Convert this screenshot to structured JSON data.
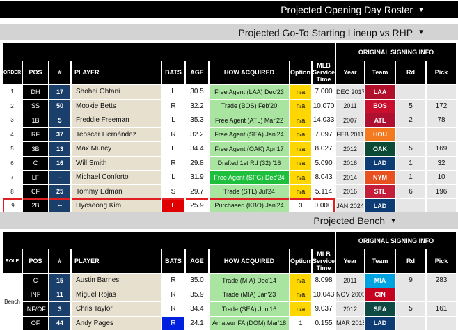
{
  "header": {
    "roster_title": "Projected Opening Day Roster",
    "lineup_title": "Projected Go-To Starting Lineup vs RHP",
    "bench_title": "Projected Bench"
  },
  "columns": {
    "order": "ORDER",
    "role": "ROLE",
    "pos": "POS",
    "num": "#",
    "player": "PLAYER",
    "bats": "BATS",
    "age": "AGE",
    "how_acquired": "HOW ACQUIRED",
    "options": "Options",
    "service": "MLB Service Time",
    "signing_header": "ORIGINAL SIGNING INFO",
    "year": "Year",
    "team": "Team",
    "rd": "Rd",
    "pick": "Pick"
  },
  "lineup": [
    {
      "order": "1",
      "pos": "DH",
      "num": "17",
      "player": "Shohei Ohtani",
      "bats": "L",
      "age": "30.5",
      "acquired": "Free Agent (LAA) Dec'23",
      "options": "n/a",
      "service": "7.000",
      "year": "DEC 2017",
      "team": "LAA",
      "team_color": "#b0102a",
      "rd": "",
      "pick": ""
    },
    {
      "order": "2",
      "pos": "SS",
      "num": "50",
      "player": "Mookie Betts",
      "bats": "R",
      "age": "32.2",
      "acquired": "Trade (BOS) Feb'20",
      "options": "n/a",
      "service": "10.070",
      "year": "2011",
      "team": "BOS",
      "team_color": "#c8102e",
      "rd": "5",
      "pick": "172"
    },
    {
      "order": "3",
      "pos": "1B",
      "num": "5",
      "player": "Freddie Freeman",
      "bats": "L",
      "age": "35.3",
      "acquired": "Free Agent (ATL) Mar'22",
      "options": "n/a",
      "service": "14.033",
      "year": "2007",
      "team": "ATL",
      "team_color": "#b01030",
      "rd": "2",
      "pick": "78"
    },
    {
      "order": "4",
      "pos": "RF",
      "num": "37",
      "player": "Teoscar Hernández",
      "bats": "R",
      "age": "32.2",
      "acquired": "Free Agent (SEA) Jan'24",
      "options": "n/a",
      "service": "7.097",
      "year": "FEB 2011",
      "team": "HOU",
      "team_color": "#f47a20",
      "rd": "",
      "pick": ""
    },
    {
      "order": "5",
      "pos": "3B",
      "num": "13",
      "player": "Max Muncy",
      "bats": "L",
      "age": "34.4",
      "acquired": "Free Agent (OAK) Apr'17",
      "options": "n/a",
      "service": "8.027",
      "year": "2012",
      "team": "OAK",
      "team_color": "#0b4a35",
      "rd": "5",
      "pick": "169"
    },
    {
      "order": "6",
      "pos": "C",
      "num": "16",
      "player": "Will Smith",
      "bats": "R",
      "age": "29.8",
      "acquired": "Drafted 1st Rd (32) '16",
      "options": "n/a",
      "service": "5.090",
      "year": "2016",
      "team": "LAD",
      "team_color": "#0d3b73",
      "rd": "1",
      "pick": "32"
    },
    {
      "order": "7",
      "pos": "LF",
      "num": "--",
      "player": "Michael Conforto",
      "bats": "L",
      "age": "31.9",
      "acquired": "Free Agent (SFG) Dec'24",
      "options": "n/a",
      "service": "8.043",
      "year": "2014",
      "team": "NYM",
      "team_color": "#e8501f",
      "rd": "1",
      "pick": "10"
    },
    {
      "order": "8",
      "pos": "CF",
      "num": "25",
      "player": "Tommy Edman",
      "bats": "S",
      "age": "29.7",
      "acquired": "Trade (STL) Jul'24",
      "options": "n/a",
      "service": "5.114",
      "year": "2016",
      "team": "STL",
      "team_color": "#c41e3a",
      "rd": "6",
      "pick": "196"
    },
    {
      "order": "9",
      "pos": "2B",
      "num": "--",
      "player": "Hyeseong Kim",
      "bats": "L",
      "age": "25.9",
      "acquired": "Purchased (KBO) Jan'24",
      "options": "3",
      "service": "0.000",
      "year": "JAN 2024",
      "team": "LAD",
      "team_color": "#0d3b73",
      "rd": "",
      "pick": ""
    }
  ],
  "bench_role": "Bench",
  "bench": [
    {
      "pos": "C",
      "num": "15",
      "player": "Austin Barnes",
      "bats": "R",
      "age": "35.0",
      "acquired": "Trade (MIA) Dec'14",
      "options": "n/a",
      "service": "8.098",
      "year": "2011",
      "team": "MIA",
      "team_color": "#00a3e0",
      "rd": "9",
      "pick": "283"
    },
    {
      "pos": "INF",
      "num": "11",
      "player": "Miguel Rojas",
      "bats": "R",
      "age": "35.9",
      "acquired": "Trade (MIA) Jan'23",
      "options": "n/a",
      "service": "10.043",
      "year": "NOV 2005",
      "team": "CIN",
      "team_color": "#c6011f",
      "rd": "",
      "pick": ""
    },
    {
      "pos": "INF/OF",
      "num": "3",
      "player": "Chris Taylor",
      "bats": "R",
      "age": "34.4",
      "acquired": "Trade (SEA) Jun'16",
      "options": "n/a",
      "service": "9.037",
      "year": "2012",
      "team": "SEA",
      "team_color": "#0c4a43",
      "rd": "5",
      "pick": "161"
    },
    {
      "pos": "OF",
      "num": "44",
      "player": "Andy Pages",
      "bats": "R",
      "age": "24.1",
      "acquired": "Amateur FA (DOM) Mar'18",
      "options": "1",
      "service": "0.155",
      "year": "MAR 2018",
      "team": "LAD",
      "team_color": "#0d3b73",
      "rd": "",
      "pick": ""
    }
  ]
}
